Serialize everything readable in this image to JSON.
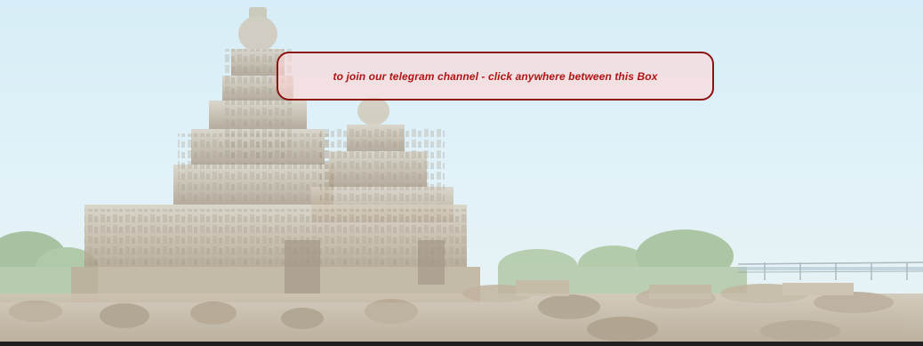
{
  "banner": {
    "text": "to join our telegram channel - click anywhere between this Box"
  },
  "background": {
    "image": "shore-temple-photo",
    "sky_color": "#d7edf7",
    "stone_color": "#b9aa95"
  },
  "colors": {
    "box_border": "#8d1010",
    "box_text": "#b01414",
    "box_fill": "#ffd6d6"
  }
}
